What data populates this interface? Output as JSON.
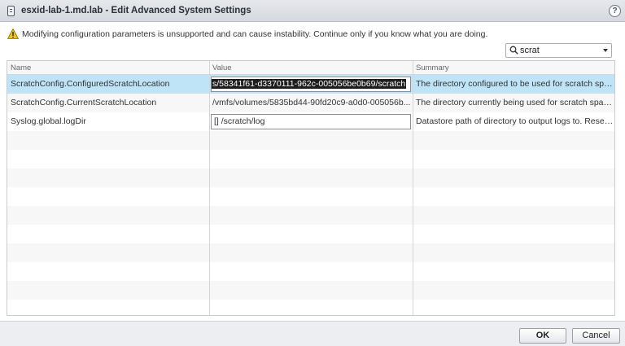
{
  "window": {
    "title": "esxid-lab-1.md.lab - Edit Advanced System Settings",
    "help_label": "?"
  },
  "warning": {
    "text": "Modifying configuration parameters is unsupported and can cause instability. Continue only if you know what you are doing.",
    "icon": "warning-triangle-icon",
    "color": "#e3b505"
  },
  "search": {
    "value": "scrat",
    "icon": "search-icon"
  },
  "table": {
    "columns": [
      "Name",
      "Value",
      "Summary"
    ],
    "rows": [
      {
        "name": "ScratchConfig.ConfiguredScratchLocation",
        "value": "s/58341f61-d3370111-962c-005056be0b69/scratch",
        "summary": "The directory configured to be used for scratch spac...",
        "selected": true,
        "editing": true
      },
      {
        "name": "ScratchConfig.CurrentScratchLocation",
        "value": "/vmfs/volumes/5835bd44-90fd20c9-a0d0-005056b...",
        "summary": "The directory currently being used for scratch space.",
        "selected": false,
        "editing": false
      },
      {
        "name": "Syslog.global.logDir",
        "value": "[] /scratch/log",
        "summary": "Datastore path of directory to output logs to. Reset t...",
        "selected": false,
        "editing": true
      }
    ],
    "selected_row_color": "#bfe3f7"
  },
  "footer": {
    "ok_label": "OK",
    "cancel_label": "Cancel"
  }
}
